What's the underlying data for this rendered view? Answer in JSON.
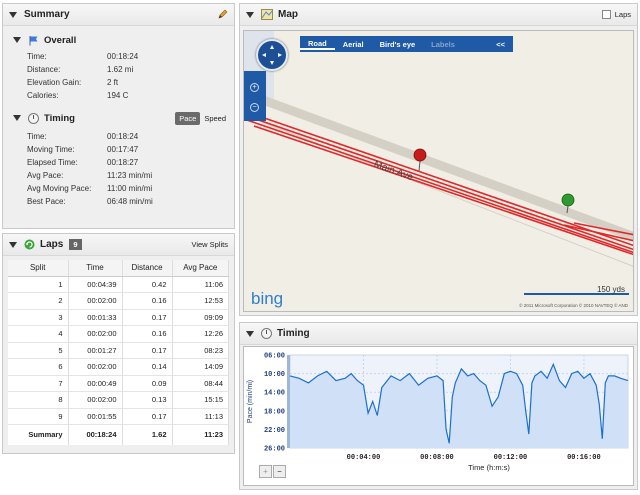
{
  "summary": {
    "title": "Summary",
    "overall": {
      "title": "Overall",
      "rows": [
        {
          "label": "Time:",
          "value": "00:18:24"
        },
        {
          "label": "Distance:",
          "value": "1.62 mi"
        },
        {
          "label": "Elevation Gain:",
          "value": "2 ft"
        },
        {
          "label": "Calories:",
          "value": "194 C"
        }
      ]
    },
    "timing": {
      "title": "Timing",
      "toggle": {
        "pace": "Pace",
        "speed": "Speed"
      },
      "rows": [
        {
          "label": "Time:",
          "value": "00:18:24"
        },
        {
          "label": "Moving Time:",
          "value": "00:17:47"
        },
        {
          "label": "Elapsed Time:",
          "value": "00:18:27"
        },
        {
          "label": "Avg Pace:",
          "value": "11:23 min/mi"
        },
        {
          "label": "Avg Moving Pace:",
          "value": "11:00 min/mi"
        },
        {
          "label": "Best Pace:",
          "value": "06:48 min/mi"
        }
      ]
    }
  },
  "laps": {
    "title": "Laps",
    "count": "9",
    "view_splits": "View Splits",
    "columns": [
      "Split",
      "Time",
      "Distance",
      "Avg Pace"
    ],
    "rows": [
      [
        "1",
        "00:04:39",
        "0.42",
        "11:06"
      ],
      [
        "2",
        "00:02:00",
        "0.16",
        "12:53"
      ],
      [
        "3",
        "00:01:33",
        "0.17",
        "09:09"
      ],
      [
        "4",
        "00:02:00",
        "0.16",
        "12:26"
      ],
      [
        "5",
        "00:01:27",
        "0.17",
        "08:23"
      ],
      [
        "6",
        "00:02:00",
        "0.14",
        "14:09"
      ],
      [
        "7",
        "00:00:49",
        "0.09",
        "08:44"
      ],
      [
        "8",
        "00:02:00",
        "0.13",
        "15:15"
      ],
      [
        "9",
        "00:01:55",
        "0.17",
        "11:13"
      ]
    ],
    "summary_row": [
      "Summary",
      "00:18:24",
      "1.62",
      "11:23"
    ]
  },
  "map": {
    "title": "Map",
    "laps_label": "Laps",
    "tabs": [
      "Road",
      "Aerial",
      "Bird's eye",
      "Labels"
    ],
    "collapse": "<<",
    "street": "Main Ave",
    "scale": "150 yds",
    "brand": "bing",
    "copyright": "© 2011 Microsoft Corporation  © 2010 NAVTEQ  © AND"
  },
  "timing_chart": {
    "title": "Timing",
    "zoom_in": "+",
    "zoom_out": "−"
  },
  "chart_data": {
    "type": "area",
    "title": "",
    "xlabel": "Time (h:m:s)",
    "ylabel": "Pace (min/mi)",
    "yticks": [
      "06:00",
      "10:00",
      "14:00",
      "18:00",
      "22:00",
      "26:00"
    ],
    "xticks": [
      "00:04:00",
      "00:08:00",
      "00:12:00",
      "00:16:00"
    ],
    "ylim_minutes": [
      6,
      26
    ],
    "y_inverted": true,
    "xlim_seconds": [
      0,
      1104
    ],
    "x_seconds": [
      0,
      30,
      60,
      90,
      120,
      150,
      180,
      200,
      220,
      240,
      255,
      270,
      285,
      300,
      330,
      360,
      390,
      420,
      450,
      480,
      500,
      510,
      520,
      530,
      540,
      560,
      580,
      600,
      620,
      640,
      660,
      680,
      700,
      720,
      740,
      760,
      770,
      780,
      790,
      800,
      820,
      840,
      860,
      880,
      900,
      920,
      940,
      960,
      980,
      1000,
      1010,
      1020,
      1030,
      1040,
      1060,
      1080,
      1104
    ],
    "pace_minutes": [
      10.5,
      11.0,
      12.0,
      10.5,
      9.5,
      11.5,
      11.0,
      10.0,
      11.5,
      12.5,
      18.5,
      16.0,
      19.0,
      13.0,
      10.5,
      11.5,
      10.0,
      12.5,
      11.0,
      10.5,
      11.5,
      22.0,
      25.0,
      15.0,
      12.0,
      9.0,
      10.5,
      10.0,
      11.5,
      12.5,
      17.0,
      15.0,
      10.0,
      9.5,
      10.0,
      12.5,
      18.0,
      23.0,
      12.0,
      10.5,
      9.5,
      11.0,
      8.0,
      11.5,
      13.0,
      10.0,
      9.5,
      11.0,
      10.0,
      12.5,
      16.5,
      24.0,
      12.0,
      10.5,
      10.5,
      11.0,
      11.5
    ],
    "grid": true,
    "color": "#1b6fd1",
    "fill": "#cfe0f7"
  }
}
